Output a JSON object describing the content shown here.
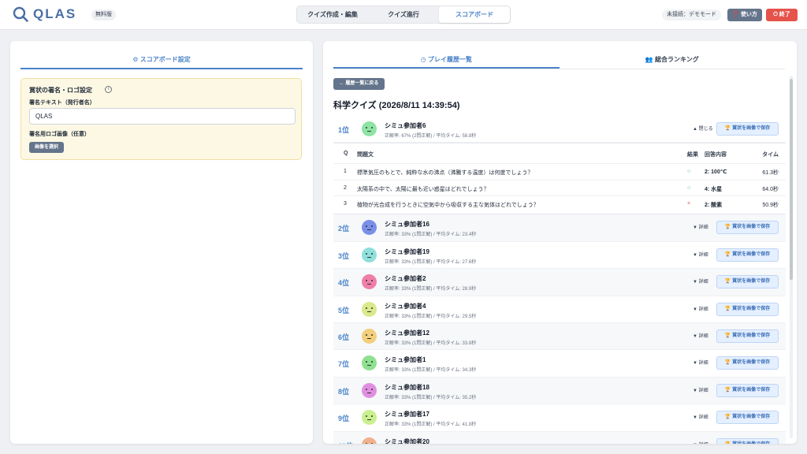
{
  "header": {
    "logo_text": "QLAS",
    "badge": "無料版",
    "tabs": [
      {
        "label": "クイズ作成・編集",
        "active": false
      },
      {
        "label": "クイズ進行",
        "active": false
      },
      {
        "label": "スコアボード",
        "active": true
      }
    ],
    "connection_status": "未接続：デモモード",
    "help_label": "使い方",
    "exit_label": "終了"
  },
  "left": {
    "tab_label": "スコアボード設定",
    "signature_title": "賞状の署名・ロゴ設定",
    "signature_text_label": "署名テキスト（発行者名）",
    "signature_text_value": "QLAS",
    "logo_label": "署名用ロゴ画像（任意）",
    "select_image_label": "画像を選択"
  },
  "right": {
    "tabs": [
      {
        "label": "プレイ履歴一覧",
        "active": true
      },
      {
        "label": "総合ランキング",
        "active": false
      }
    ],
    "back_label": "← 履歴一覧に戻る",
    "quiz_title": "科学クイズ (2026/8/11 14:39:54)",
    "cert_button_label": "賞状を画像で保存",
    "expanded_toggle": "▲ 閉じる",
    "collapsed_toggle": "▼ 詳細",
    "detail_headers": {
      "q": "Q",
      "question": "問題文",
      "result": "結果",
      "answer": "回答内容",
      "time": "タイム"
    },
    "detail_rows": [
      {
        "no": "1",
        "question": "標準気圧のもとで、純粋な水の沸点（沸騰する温度）は何度でしょう？",
        "result": "○",
        "correct": true,
        "answer": "2: 100℃",
        "time": "61.3秒"
      },
      {
        "no": "2",
        "question": "太陽系の中で、太陽に最も近い惑星はどれでしょう？",
        "result": "○",
        "correct": true,
        "answer": "4: 水星",
        "time": "64.0秒"
      },
      {
        "no": "3",
        "question": "植物が光合成を行うときに空気中から吸収する主な気体はどれでしょう？",
        "result": "×",
        "correct": false,
        "answer": "2: 酸素",
        "time": "50.9秒"
      }
    ],
    "players": [
      {
        "rank": "1位",
        "name": "シミュ参加者6",
        "stats": "正解率: 67% (2問正解) / 平均タイム: 58.8秒",
        "avatar_color": "#8fe3a3",
        "expanded": true
      },
      {
        "rank": "2位",
        "name": "シミュ参加者16",
        "stats": "正解率: 33% (1問正解) / 平均タイム: 23.4秒",
        "avatar_color": "#7a8fe8",
        "expanded": false
      },
      {
        "rank": "3位",
        "name": "シミュ参加者19",
        "stats": "正解率: 33% (1問正解) / 平均タイム: 27.6秒",
        "avatar_color": "#8fe0dc",
        "expanded": false
      },
      {
        "rank": "4位",
        "name": "シミュ参加者2",
        "stats": "正解率: 33% (1問正解) / 平均タイム: 28.9秒",
        "avatar_color": "#ee7fa8",
        "expanded": false
      },
      {
        "rank": "5位",
        "name": "シミュ参加者4",
        "stats": "正解率: 33% (1問正解) / 平均タイム: 29.5秒",
        "avatar_color": "#d9e98c",
        "expanded": false
      },
      {
        "rank": "6位",
        "name": "シミュ参加者12",
        "stats": "正解率: 33% (1問正解) / 平均タイム: 33.8秒",
        "avatar_color": "#f2cf7c",
        "expanded": false
      },
      {
        "rank": "7位",
        "name": "シミュ参加者1",
        "stats": "正解率: 33% (1問正解) / 平均タイム: 34.3秒",
        "avatar_color": "#8fe08f",
        "expanded": false
      },
      {
        "rank": "8位",
        "name": "シミュ参加者18",
        "stats": "正解率: 33% (1問正解) / 平均タイム: 35.2秒",
        "avatar_color": "#e08fe0",
        "expanded": false
      },
      {
        "rank": "9位",
        "name": "シミュ参加者17",
        "stats": "正解率: 33% (1問正解) / 平均タイム: 41.8秒",
        "avatar_color": "#c9ef8f",
        "expanded": false
      },
      {
        "rank": "10位",
        "name": "シミュ参加者20",
        "stats": "",
        "avatar_color": "#f2b08a",
        "expanded": false
      }
    ]
  },
  "colors": {
    "accent": "#4b83c9",
    "exit": "#e5534b",
    "help": "#64748b"
  }
}
